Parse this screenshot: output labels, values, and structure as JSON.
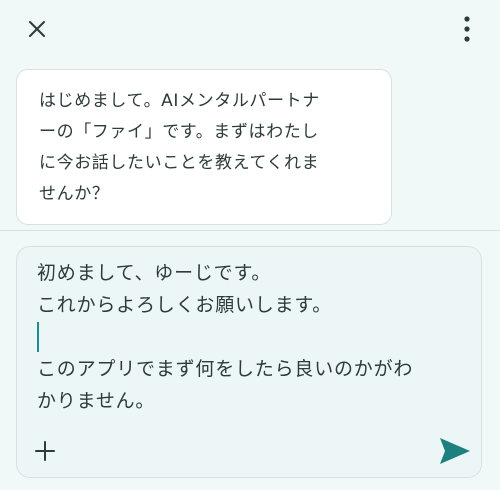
{
  "header": {
    "close_icon": "close-icon",
    "menu_icon": "more-vertical-icon"
  },
  "message": {
    "lines": [
      "はじめまして。AIメンタルパートナ",
      "ーの「ファイ」です。まずはわたし",
      "に今お話したいことを教えてくれま",
      "せんか？"
    ]
  },
  "composer": {
    "lines": [
      "初めまして、ゆーじです。",
      "これからよろしくお願いします。",
      "",
      "このアプリでまず何をしたら良いのかがわ",
      "かりません。"
    ],
    "add_icon": "plus-icon",
    "send_icon": "send-icon"
  },
  "colors": {
    "background": "#f0f8f8",
    "accent": "#1e7f7f",
    "text": "#2d3b3b",
    "border": "#d6e2e2"
  }
}
